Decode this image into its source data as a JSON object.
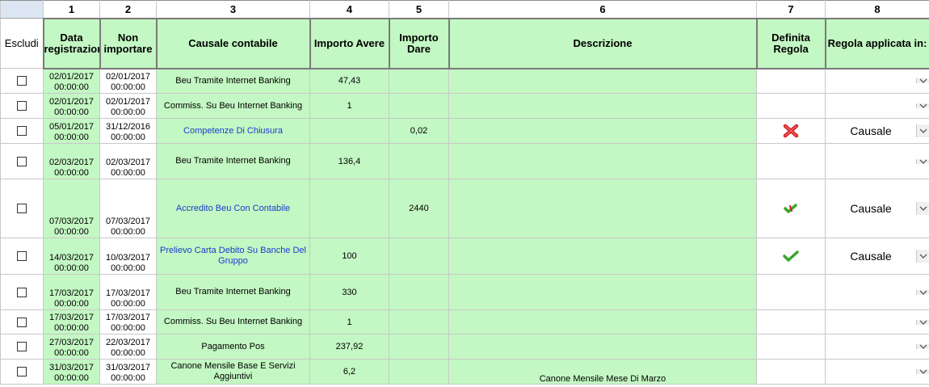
{
  "columns": {
    "numbers": [
      "1",
      "2",
      "3",
      "4",
      "5",
      "6",
      "7",
      "8"
    ],
    "escludi": "Escludi",
    "headers": {
      "data_registrazione": "Data registrazione",
      "non_importare": "Non importare",
      "causale_contabile": "Causale contabile",
      "importo_avere": "Importo Avere",
      "importo_dare": "Importo Dare",
      "descrizione": "Descrizione",
      "definita_regola": "Definita Regola",
      "regola_applicata": "Regola applicata in:"
    }
  },
  "rows": [
    {
      "d1": "02/01/2017",
      "t1": "00:00:00",
      "d2": "02/01/2017",
      "t2": "00:00:00",
      "causale": "Beu Tramite Internet Banking",
      "avere": "47,43",
      "dare": "",
      "descrizione": "",
      "regola_icon": "",
      "regola": ""
    },
    {
      "d1": "02/01/2017",
      "t1": "00:00:00",
      "d2": "02/01/2017",
      "t2": "00:00:00",
      "causale": "Commiss. Su Beu Internet Banking",
      "avere": "1",
      "dare": "",
      "descrizione": "",
      "regola_icon": "",
      "regola": ""
    },
    {
      "d1": "05/01/2017",
      "t1": "00:00:00",
      "d2": "31/12/2016",
      "t2": "00:00:00",
      "causale": "Competenze Di Chiusura",
      "avere": "",
      "dare": "0,02",
      "descrizione": "",
      "regola_icon": "red-x-icon",
      "regola": "Causale"
    },
    {
      "d1": "02/03/2017",
      "t1": "00:00:00",
      "d2": "02/03/2017",
      "t2": "00:00:00",
      "causale": "Beu Tramite Internet Banking",
      "avere": "136,4",
      "dare": "",
      "descrizione": "",
      "regola_icon": "",
      "regola": ""
    },
    {
      "d1": "07/03/2017",
      "t1": "00:00:00",
      "d2": "07/03/2017",
      "t2": "00:00:00",
      "causale": "Accredito Beu Con Contabile",
      "avere": "",
      "dare": "2440",
      "descrizione": "",
      "regola_icon": "partial-check-icon",
      "regola": "Causale"
    },
    {
      "d1": "14/03/2017",
      "t1": "00:00:00",
      "d2": "10/03/2017",
      "t2": "00:00:00",
      "causale": "Prelievo Carta Debito Su Banche Del Gruppo",
      "avere": "100",
      "dare": "",
      "descrizione": "",
      "regola_icon": "green-check-icon",
      "regola": "Causale"
    },
    {
      "d1": "17/03/2017",
      "t1": "00:00:00",
      "d2": "17/03/2017",
      "t2": "00:00:00",
      "causale": "Beu Tramite Internet Banking",
      "avere": "330",
      "dare": "",
      "descrizione": "",
      "regola_icon": "",
      "regola": ""
    },
    {
      "d1": "17/03/2017",
      "t1": "00:00:00",
      "d2": "17/03/2017",
      "t2": "00:00:00",
      "causale": "Commiss. Su Beu Internet Banking",
      "avere": "1",
      "dare": "",
      "descrizione": "",
      "regola_icon": "",
      "regola": ""
    },
    {
      "d1": "27/03/2017",
      "t1": "00:00:00",
      "d2": "22/03/2017",
      "t2": "00:00:00",
      "causale": "Pagamento Pos",
      "avere": "237,92",
      "dare": "",
      "descrizione": "",
      "regola_icon": "",
      "regola": ""
    },
    {
      "d1": "31/03/2017",
      "t1": "00:00:00",
      "d2": "31/03/2017",
      "t2": "00:00:00",
      "causale": "Canone Mensile Base E Servizi Aggiuntivi",
      "avere": "6,2",
      "dare": "",
      "descrizione": "Canone Mensile Mese Di Marzo",
      "regola_icon": "",
      "regola": ""
    }
  ],
  "colors": {
    "green_cell": "#c3f7c3",
    "link_text": "#1a3ccc",
    "error_red": "#d42020",
    "check_green": "#3aa52a"
  }
}
